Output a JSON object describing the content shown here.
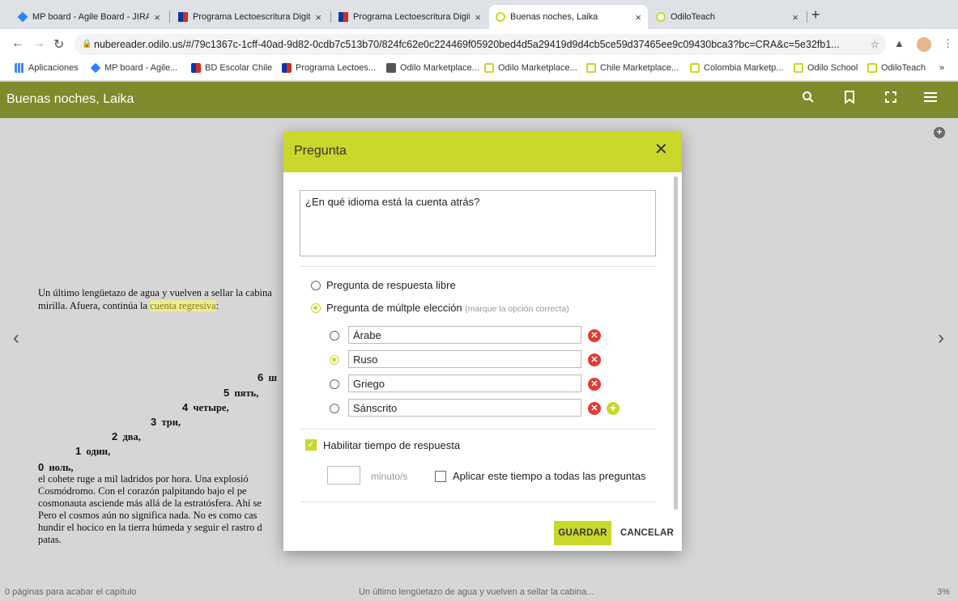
{
  "browser": {
    "tabs": [
      {
        "title": "MP board - Agile Board - JIRA",
        "close": "×"
      },
      {
        "title": "Programa Lectoescritura Digital",
        "close": "×"
      },
      {
        "title": "Programa Lectoescritura Digital",
        "close": "×"
      },
      {
        "title": "Buenas noches, Laika",
        "close": "×"
      },
      {
        "title": "OdiloTeach",
        "close": "×"
      }
    ],
    "new_tab": "+",
    "url": "nubereader.odilo.us/#/79c1367c-1cff-40ad-9d82-0cdb7c513b70/824fc62e0c224469f05920bed4d5a29419d9d4cb5ce59d37465ee9c09430bca3?bc=CRA&c=5e32fb1...",
    "bookmarks": [
      "Aplicaciones",
      "MP board - Agile...",
      "BD Escolar Chile",
      "Programa Lectoes...",
      "Odilo Marketplace...",
      "Odilo Marketplace...",
      "Chile Marketplace...",
      "Colombia Marketp...",
      "Odilo School",
      "OdiloTeach"
    ],
    "more_bookmarks": "»"
  },
  "app": {
    "title": "Buenas noches, Laika"
  },
  "book": {
    "line1": "Un último lengüetazo de agua y vuelven a sellar la cabina",
    "line2_pre": "mirilla. Afuera, continúa la ",
    "line2_highlight": "cuenta regresiva",
    "line2_post": ":",
    "countdown": [
      {
        "n": "6",
        "w": "ш"
      },
      {
        "n": "5",
        "w": "пять,"
      },
      {
        "n": "4",
        "w": "четыре,"
      },
      {
        "n": "3",
        "w": "три,"
      },
      {
        "n": "2",
        "w": "два,"
      },
      {
        "n": "1",
        "w": "один,"
      },
      {
        "n": "0",
        "w": "ноль,"
      }
    ],
    "para": [
      "el cohete ruge a mil ladridos por hora. Una explosió",
      "Cosmódromo. Con el corazón palpitando bajo el pe",
      "cosmonauta asciende más allá de la estratósfera. Ahí se",
      "Pero el cosmos aún no significa nada. No es como cas",
      "hundir el hocico en la tierra húmeda y seguir el rastro d",
      "patas."
    ]
  },
  "footer": {
    "left": "0 páginas para acabar el capítulo",
    "center": "Un último lengüetazo de agua y vuelven a sellar la cabina...",
    "right": "3%"
  },
  "modal": {
    "title": "Pregunta",
    "question": "¿En qué idioma está la cuenta atrás?",
    "type_free": "Pregunta de respuesta libre",
    "type_multi": "Pregunta de múltple elección",
    "type_multi_hint": "(marque la opción correcta)",
    "answers": [
      "Árabe",
      "Ruso",
      "Griego",
      "Sánscrito"
    ],
    "correct_index": 1,
    "enable_time": "Habilitar tiempo de respuesta",
    "time_value": "",
    "time_unit": "minuto/s",
    "apply_all": "Aplicar este tiempo a todas las preguntas",
    "save": "GUARDAR",
    "cancel": "CANCELAR"
  }
}
